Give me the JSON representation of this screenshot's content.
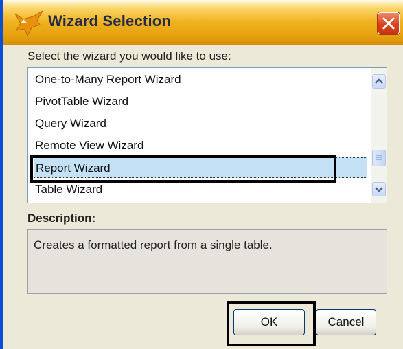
{
  "window": {
    "title": "Wizard Selection",
    "icon": "fox-icon",
    "close_icon": "close-icon"
  },
  "prompt": "Select the wizard you would like to use:",
  "wizards": [
    {
      "label": "One-to-Many Report Wizard",
      "selected": false
    },
    {
      "label": "PivotTable Wizard",
      "selected": false
    },
    {
      "label": "Query Wizard",
      "selected": false
    },
    {
      "label": "Remote View Wizard",
      "selected": false
    },
    {
      "label": "Report Wizard",
      "selected": true
    },
    {
      "label": "Table Wizard",
      "selected": false
    }
  ],
  "description": {
    "label": "Description:",
    "text": "Creates a formatted report from a single table."
  },
  "buttons": {
    "ok": "OK",
    "cancel": "Cancel"
  },
  "colors": {
    "selection": "#c4e1f6",
    "titlebar": "#f0b31f",
    "highlight": "#000000"
  }
}
